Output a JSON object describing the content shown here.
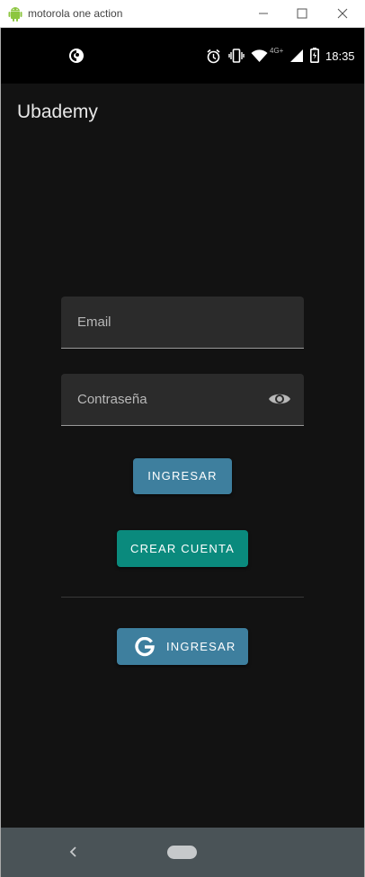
{
  "window": {
    "title": "motorola one action"
  },
  "status_bar": {
    "time": "18:35",
    "network_label": "4G+",
    "icons": [
      "notification-icon",
      "alarm-icon",
      "vibrate-icon",
      "wifi-icon",
      "signal-icon",
      "battery-icon"
    ]
  },
  "app_bar": {
    "title": "Ubademy"
  },
  "login_form": {
    "email_placeholder": "Email",
    "password_placeholder": "Contraseña",
    "login_button": "INGRESAR",
    "create_account_button": "CREAR CUENTA",
    "google_login_button": "INGRESAR"
  },
  "colors": {
    "background": "#121212",
    "primary_button": "#3e7f9e",
    "secondary_button": "#0a8a7d",
    "field_background": "#2b2b2b",
    "nav_bar": "#4a5357"
  }
}
